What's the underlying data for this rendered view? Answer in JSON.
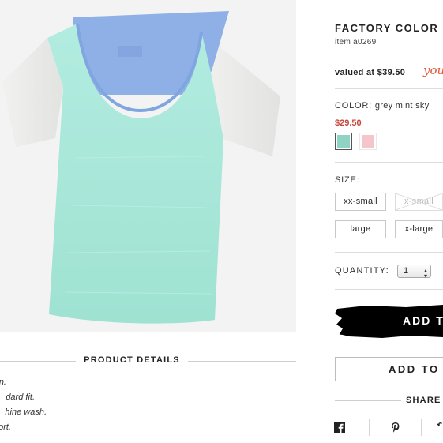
{
  "product": {
    "title": "FACTORY COLOR",
    "item_number": "item a0269",
    "valued_at": "valued at $39.50",
    "promo_script": "you",
    "color_label": "COLOR:",
    "color_value": "grey mint sky",
    "price": "$29.50",
    "swatches": [
      {
        "name": "mint",
        "color": "#8fd3c4",
        "selected": true
      },
      {
        "name": "pink",
        "color": "#f4c6cb",
        "selected": false
      }
    ],
    "size_label": "SIZE:",
    "sizes": [
      {
        "label": "xx-small",
        "available": true
      },
      {
        "label": "x-small",
        "available": false
      },
      {
        "label": "large",
        "available": true
      },
      {
        "label": "x-large",
        "available": true
      }
    ],
    "quantity_label": "QUANTITY:",
    "quantity_value": "1",
    "add_to_bag_label": "ADD T",
    "add_to_wishlist_label": "ADD TO",
    "share_label": "SHARE"
  },
  "details": {
    "heading": "PRODUCT DETAILS",
    "lines": [
      "n.",
      "dard fit.",
      "hine wash.",
      "ort."
    ]
  },
  "icons": {
    "facebook": "facebook-icon",
    "pinterest": "pinterest-icon",
    "twitter": "twitter-icon"
  },
  "colors": {
    "shirt_body": "#a6e6d6",
    "shirt_yoke": "#8fb0e6",
    "shirt_sleeve": "#ececea",
    "price_red": "#c8463a",
    "promo_orange": "#e05a3c"
  }
}
